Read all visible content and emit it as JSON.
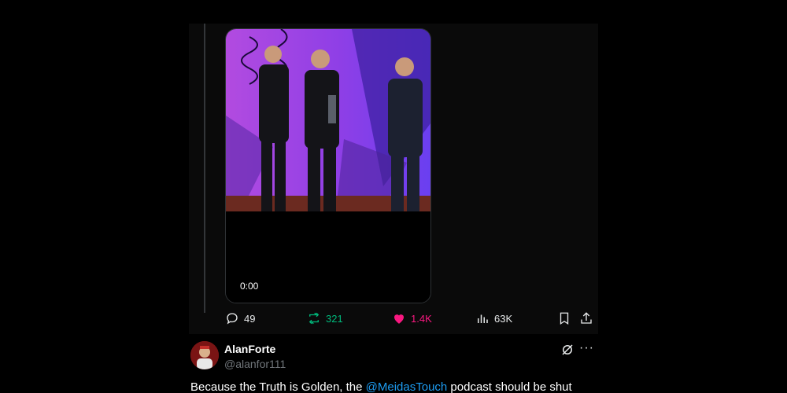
{
  "video": {
    "timestamp": "0:00"
  },
  "actions": {
    "replies": "49",
    "reposts": "321",
    "likes": "1.4K",
    "views": "63K"
  },
  "colors": {
    "repost": "#00ba7c",
    "like": "#f91880",
    "mention": "#1d9bf0",
    "muted": "#71767b"
  },
  "next_post": {
    "author_name": "AlanForte",
    "author_handle": "@alanfor111",
    "text_before": "Because the Truth is Golden, the ",
    "mention": "@MeidasTouch",
    "text_after": " podcast should be shut"
  },
  "icons": [
    "reply-icon",
    "repost-icon",
    "like-icon",
    "views-icon",
    "bookmark-icon",
    "share-icon",
    "grok-icon",
    "more-icon"
  ]
}
